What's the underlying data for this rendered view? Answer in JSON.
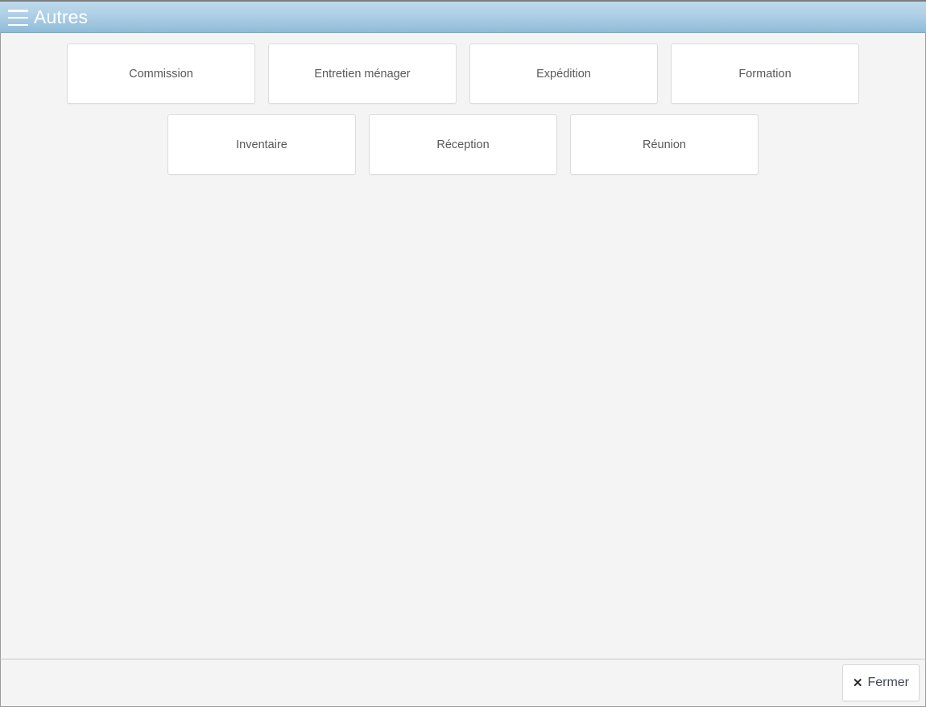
{
  "header": {
    "menu_icon": "hamburger-menu-icon",
    "title": "Autres"
  },
  "main": {
    "tile_rows": [
      [
        {
          "label": "Commission"
        },
        {
          "label": "Entretien ménager"
        },
        {
          "label": "Expédition"
        },
        {
          "label": "Formation"
        }
      ],
      [
        {
          "label": "Inventaire"
        },
        {
          "label": "Réception"
        },
        {
          "label": "Réunion"
        }
      ]
    ]
  },
  "footer": {
    "close_icon": "close-x-icon",
    "close_icon_glyph": "✕",
    "close_label": "Fermer"
  },
  "colors": {
    "header_gradient_top": "#bcd8ea",
    "header_gradient_bottom": "#8cb9d7",
    "header_text": "#ffffff",
    "page_background": "#f4f4f4",
    "tile_background": "#ffffff",
    "tile_border": "#dcdcdc",
    "tile_text": "#57585a",
    "footer_divider": "#c8c8c8",
    "close_label_text": "#404853"
  }
}
